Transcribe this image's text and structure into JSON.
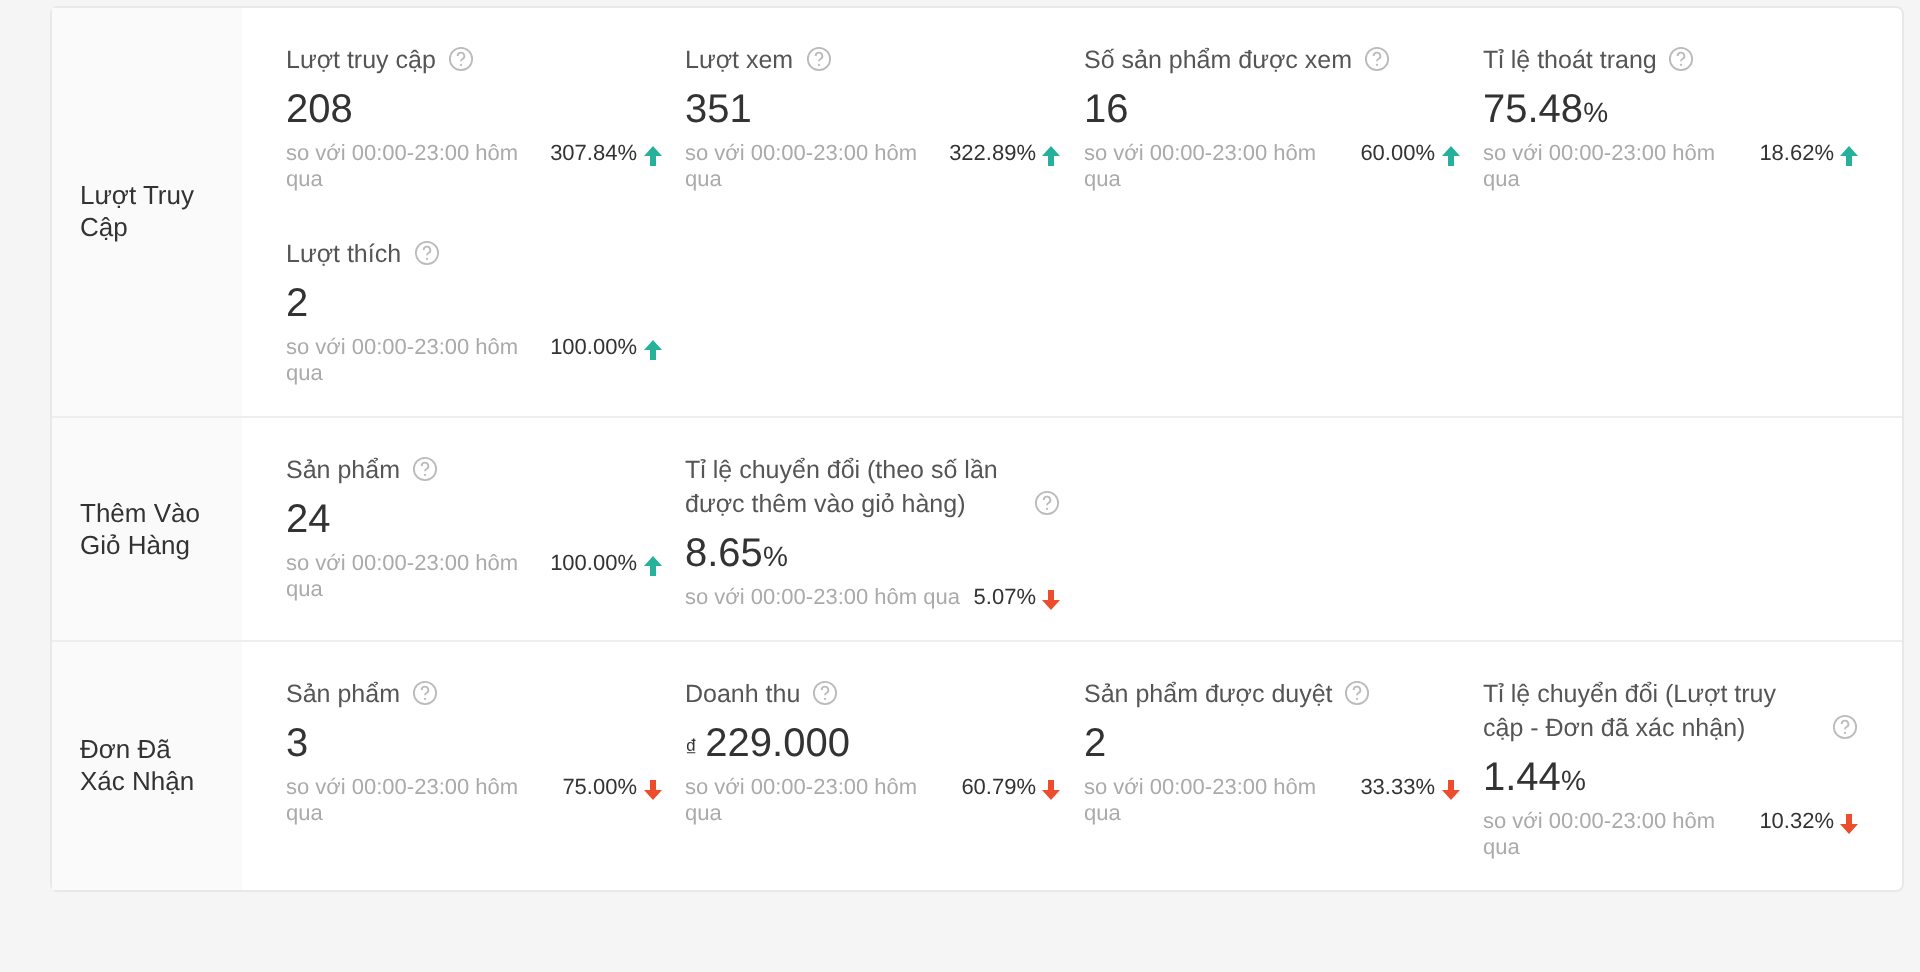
{
  "sections": [
    {
      "title": "Lượt Truy Cập",
      "metrics": [
        {
          "label": "Lượt truy cập",
          "value": "208",
          "comparison": "so với 00:00-23:00 hôm qua",
          "change": "307.84%",
          "increase": true
        },
        {
          "label": "Lượt xem",
          "value": "351",
          "comparison": "so với 00:00-23:00 hôm qua",
          "change": "322.89%",
          "increase": true
        },
        {
          "label": "Số sản phẩm được xem",
          "value": "16",
          "comparison": "so với 00:00-23:00 hôm qua",
          "change": "60.00%",
          "increase": true
        },
        {
          "label": "Tỉ lệ thoát trang",
          "value": "75.48",
          "unit": "%",
          "comparison": "so với 00:00-23:00 hôm qua",
          "change": "18.62%",
          "increase": true
        },
        {
          "label": "Lượt thích",
          "value": "2",
          "comparison": "so với 00:00-23:00 hôm qua",
          "change": "100.00%",
          "increase": true
        }
      ]
    },
    {
      "title": "Thêm Vào Giỏ Hàng",
      "metrics": [
        {
          "label": "Sản phẩm",
          "value": "24",
          "comparison": "so với 00:00-23:00 hôm qua",
          "change": "100.00%",
          "increase": true
        },
        {
          "label": "Tỉ lệ chuyển đổi (theo số lần được thêm vào giỏ hàng)",
          "value": "8.65",
          "unit": "%",
          "comparison": "so với 00:00-23:00 hôm qua",
          "change": "5.07%",
          "increase": false
        }
      ]
    },
    {
      "title": "Đơn Đã Xác Nhận",
      "metrics": [
        {
          "label": "Sản phẩm",
          "value": "3",
          "comparison": "so với 00:00-23:00 hôm qua",
          "change": "75.00%",
          "increase": false
        },
        {
          "label": "Doanh thu",
          "prefix": "₫",
          "value": "229.000",
          "comparison": "so với 00:00-23:00 hôm qua",
          "change": "60.79%",
          "increase": false
        },
        {
          "label": "Sản phẩm được duyệt",
          "value": "2",
          "comparison": "so với 00:00-23:00 hôm qua",
          "change": "33.33%",
          "increase": false
        },
        {
          "label": "Tỉ lệ chuyển đổi (Lượt truy cập - Đơn đã xác nhận)",
          "value": "1.44",
          "unit": "%",
          "comparison": "so với 00:00-23:00 hôm qua",
          "change": "10.32%",
          "increase": false
        }
      ]
    }
  ]
}
